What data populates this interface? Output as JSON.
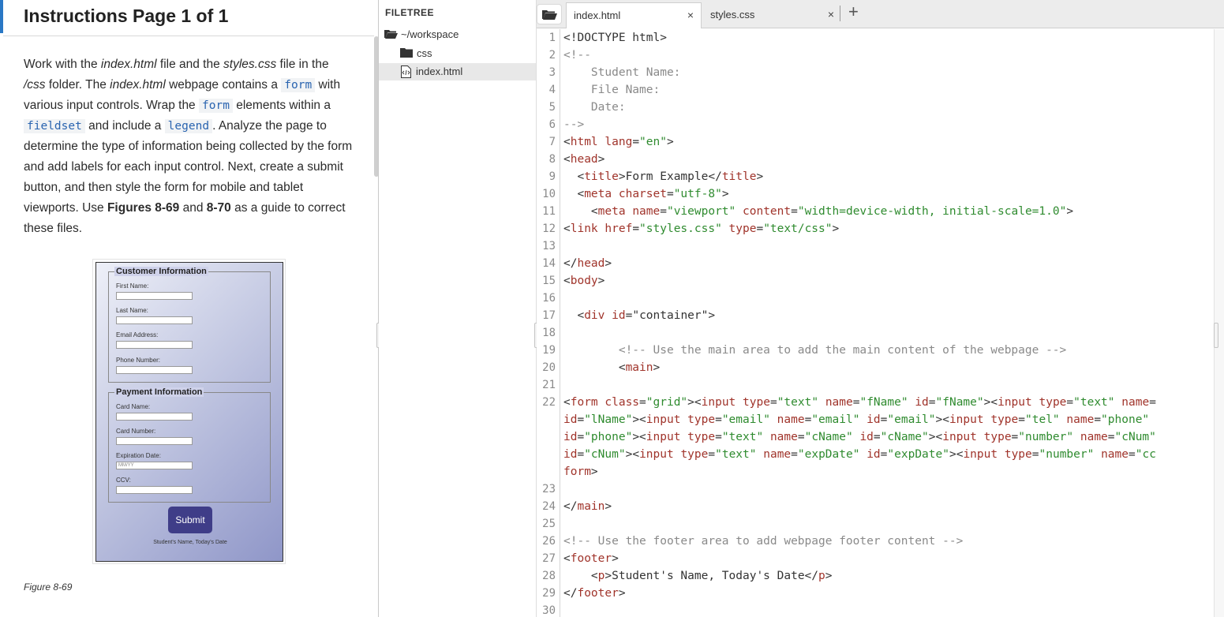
{
  "instructions": {
    "title": "Instructions Page 1 of 1",
    "p1": "Work with the ",
    "p_index": "index.html",
    "p2": " file and the ",
    "p_styles": "styles.css",
    "p3": " file in the ",
    "p_css": "/css",
    "p4": " folder. The ",
    "p_index2": "index.html",
    "p5": " webpage contains a ",
    "code_form": "form",
    "p6": " with various input controls. Wrap the ",
    "code_form2": "form",
    "p7": " elements within a ",
    "code_fieldset": "fieldset",
    "p8": " and include a ",
    "code_legend": "legend",
    "p9": ". Analyze the page to determine the type of information being collected by the form and add labels for each input control. Next, create a submit button, and then style the form for mobile and tablet viewports. Use ",
    "fig1": "Figures 8-69",
    "p10": " and ",
    "fig2": "8-70",
    "p11": " as a guide to correct these files.",
    "figure_caption": "Figure 8-69"
  },
  "figure": {
    "legend_customer": "Customer Information",
    "legend_payment": "Payment Information",
    "customer_fields": [
      "First Name:",
      "Last Name:",
      "Email Address:",
      "Phone Number:"
    ],
    "payment_fields": [
      "Card Name:",
      "Card Number:",
      "Expiration Date:",
      "CCV:"
    ],
    "exp_placeholder": "MM/YY",
    "submit": "Submit",
    "footer": "Student's Name, Today's Date"
  },
  "filetree": {
    "title": "FILETREE",
    "items": [
      "~/workspace",
      "css",
      "index.html"
    ]
  },
  "tabs": [
    {
      "label": "index.html",
      "close": "×"
    },
    {
      "label": "styles.css",
      "close": "×"
    }
  ],
  "tab_add": "+",
  "code_lines": [
    [
      [
        "p",
        "<!DOCTYPE html>"
      ]
    ],
    [
      [
        "c",
        "<!--"
      ]
    ],
    [
      [
        "c",
        "    Student Name:"
      ]
    ],
    [
      [
        "c",
        "    File Name:"
      ]
    ],
    [
      [
        "c",
        "    Date:"
      ]
    ],
    [
      [
        "c",
        "-->"
      ]
    ],
    [
      [
        "p",
        "<"
      ],
      [
        "t",
        "html"
      ],
      [
        "p",
        " "
      ],
      [
        "a",
        "lang"
      ],
      [
        "p",
        "="
      ],
      [
        "v",
        "\"en\""
      ],
      [
        "p",
        ">"
      ]
    ],
    [
      [
        "p",
        "<"
      ],
      [
        "t",
        "head"
      ],
      [
        "p",
        ">"
      ]
    ],
    [
      [
        "p",
        "  <"
      ],
      [
        "t",
        "title"
      ],
      [
        "p",
        ">Form Example</"
      ],
      [
        "t",
        "title"
      ],
      [
        "p",
        ">"
      ]
    ],
    [
      [
        "p",
        "  <"
      ],
      [
        "t",
        "meta"
      ],
      [
        "p",
        " "
      ],
      [
        "a",
        "charset"
      ],
      [
        "p",
        "="
      ],
      [
        "v",
        "\"utf-8\""
      ],
      [
        "p",
        ">"
      ]
    ],
    [
      [
        "p",
        "    <"
      ],
      [
        "t",
        "meta"
      ],
      [
        "p",
        " "
      ],
      [
        "a",
        "name"
      ],
      [
        "p",
        "="
      ],
      [
        "v",
        "\"viewport\""
      ],
      [
        "p",
        " "
      ],
      [
        "a",
        "content"
      ],
      [
        "p",
        "="
      ],
      [
        "v",
        "\"width=device-width, initial-scale=1.0\""
      ],
      [
        "p",
        ">"
      ]
    ],
    [
      [
        "p",
        "<"
      ],
      [
        "t",
        "link"
      ],
      [
        "p",
        " "
      ],
      [
        "a",
        "href"
      ],
      [
        "p",
        "="
      ],
      [
        "v",
        "\"styles.css\""
      ],
      [
        "p",
        " "
      ],
      [
        "a",
        "type"
      ],
      [
        "p",
        "="
      ],
      [
        "v",
        "\"text/css\""
      ],
      [
        "p",
        ">"
      ]
    ],
    [],
    [
      [
        "p",
        "</"
      ],
      [
        "t",
        "head"
      ],
      [
        "p",
        ">"
      ]
    ],
    [
      [
        "p",
        "<"
      ],
      [
        "t",
        "body"
      ],
      [
        "p",
        ">"
      ]
    ],
    [],
    [
      [
        "p",
        "  <"
      ],
      [
        "t",
        "div"
      ],
      [
        "p",
        " "
      ],
      [
        "a",
        "id"
      ],
      [
        "p",
        "="
      ],
      [
        "p",
        "\"container\""
      ],
      [
        "p",
        ">"
      ]
    ],
    [],
    [
      [
        "c",
        "        <!-- Use the main area to add the main content of the webpage -->"
      ]
    ],
    [
      [
        "p",
        "        <"
      ],
      [
        "t",
        "main"
      ],
      [
        "p",
        ">"
      ]
    ],
    [],
    [
      [
        "p",
        "<"
      ],
      [
        "t",
        "form"
      ],
      [
        "p",
        " "
      ],
      [
        "a",
        "class"
      ],
      [
        "p",
        "="
      ],
      [
        "v",
        "\"grid\""
      ],
      [
        "p",
        "><"
      ],
      [
        "t",
        "input"
      ],
      [
        "p",
        " "
      ],
      [
        "a",
        "type"
      ],
      [
        "p",
        "="
      ],
      [
        "v",
        "\"text\""
      ],
      [
        "p",
        " "
      ],
      [
        "a",
        "name"
      ],
      [
        "p",
        "="
      ],
      [
        "v",
        "\"fName\""
      ],
      [
        "p",
        " "
      ],
      [
        "a",
        "id"
      ],
      [
        "p",
        "="
      ],
      [
        "v",
        "\"fName\""
      ],
      [
        "p",
        "><"
      ],
      [
        "t",
        "input"
      ],
      [
        "p",
        " "
      ],
      [
        "a",
        "type"
      ],
      [
        "p",
        "="
      ],
      [
        "v",
        "\"text\""
      ],
      [
        "p",
        " "
      ],
      [
        "a",
        "name"
      ],
      [
        "p",
        "="
      ]
    ],
    [
      [
        "a",
        "id"
      ],
      [
        "p",
        "="
      ],
      [
        "v",
        "\"lName\""
      ],
      [
        "p",
        "><"
      ],
      [
        "t",
        "input"
      ],
      [
        "p",
        " "
      ],
      [
        "a",
        "type"
      ],
      [
        "p",
        "="
      ],
      [
        "v",
        "\"email\""
      ],
      [
        "p",
        " "
      ],
      [
        "a",
        "name"
      ],
      [
        "p",
        "="
      ],
      [
        "v",
        "\"email\""
      ],
      [
        "p",
        " "
      ],
      [
        "a",
        "id"
      ],
      [
        "p",
        "="
      ],
      [
        "v",
        "\"email\""
      ],
      [
        "p",
        "><"
      ],
      [
        "t",
        "input"
      ],
      [
        "p",
        " "
      ],
      [
        "a",
        "type"
      ],
      [
        "p",
        "="
      ],
      [
        "v",
        "\"tel\""
      ],
      [
        "p",
        " "
      ],
      [
        "a",
        "name"
      ],
      [
        "p",
        "="
      ],
      [
        "v",
        "\"phone\""
      ]
    ],
    [
      [
        "a",
        "id"
      ],
      [
        "p",
        "="
      ],
      [
        "v",
        "\"phone\""
      ],
      [
        "p",
        "><"
      ],
      [
        "t",
        "input"
      ],
      [
        "p",
        " "
      ],
      [
        "a",
        "type"
      ],
      [
        "p",
        "="
      ],
      [
        "v",
        "\"text\""
      ],
      [
        "p",
        " "
      ],
      [
        "a",
        "name"
      ],
      [
        "p",
        "="
      ],
      [
        "v",
        "\"cName\""
      ],
      [
        "p",
        " "
      ],
      [
        "a",
        "id"
      ],
      [
        "p",
        "="
      ],
      [
        "v",
        "\"cName\""
      ],
      [
        "p",
        "><"
      ],
      [
        "t",
        "input"
      ],
      [
        "p",
        " "
      ],
      [
        "a",
        "type"
      ],
      [
        "p",
        "="
      ],
      [
        "v",
        "\"number\""
      ],
      [
        "p",
        " "
      ],
      [
        "a",
        "name"
      ],
      [
        "p",
        "="
      ],
      [
        "v",
        "\"cNum\""
      ]
    ],
    [
      [
        "a",
        "id"
      ],
      [
        "p",
        "="
      ],
      [
        "v",
        "\"cNum\""
      ],
      [
        "p",
        "><"
      ],
      [
        "t",
        "input"
      ],
      [
        "p",
        " "
      ],
      [
        "a",
        "type"
      ],
      [
        "p",
        "="
      ],
      [
        "v",
        "\"text\""
      ],
      [
        "p",
        " "
      ],
      [
        "a",
        "name"
      ],
      [
        "p",
        "="
      ],
      [
        "v",
        "\"expDate\""
      ],
      [
        "p",
        " "
      ],
      [
        "a",
        "id"
      ],
      [
        "p",
        "="
      ],
      [
        "v",
        "\"expDate\""
      ],
      [
        "p",
        "><"
      ],
      [
        "t",
        "input"
      ],
      [
        "p",
        " "
      ],
      [
        "a",
        "type"
      ],
      [
        "p",
        "="
      ],
      [
        "v",
        "\"number\""
      ],
      [
        "p",
        " "
      ],
      [
        "a",
        "name"
      ],
      [
        "p",
        "="
      ],
      [
        "v",
        "\"cc"
      ]
    ],
    [
      [
        "t",
        "form"
      ],
      [
        "p",
        ">"
      ]
    ],
    [],
    [
      [
        "p",
        "</"
      ],
      [
        "t",
        "main"
      ],
      [
        "p",
        ">"
      ]
    ],
    [],
    [
      [
        "c",
        "<!-- Use the footer area to add webpage footer content -->"
      ]
    ],
    [
      [
        "p",
        "<"
      ],
      [
        "t",
        "footer"
      ],
      [
        "p",
        ">"
      ]
    ],
    [
      [
        "p",
        "    <"
      ],
      [
        "t",
        "p"
      ],
      [
        "p",
        ">Student's Name, Today's Date</"
      ],
      [
        "t",
        "p"
      ],
      [
        "p",
        ">"
      ]
    ],
    [
      [
        "p",
        "</"
      ],
      [
        "t",
        "footer"
      ],
      [
        "p",
        ">"
      ]
    ],
    []
  ],
  "line_numbers": [
    "1",
    "2",
    "3",
    "4",
    "5",
    "6",
    "7",
    "8",
    "9",
    "10",
    "11",
    "12",
    "13",
    "14",
    "15",
    "16",
    "17",
    "18",
    "19",
    "20",
    "21",
    "22",
    "",
    "",
    "",
    "",
    "23",
    "24",
    "25",
    "26",
    "27",
    "28",
    "29",
    "30"
  ]
}
